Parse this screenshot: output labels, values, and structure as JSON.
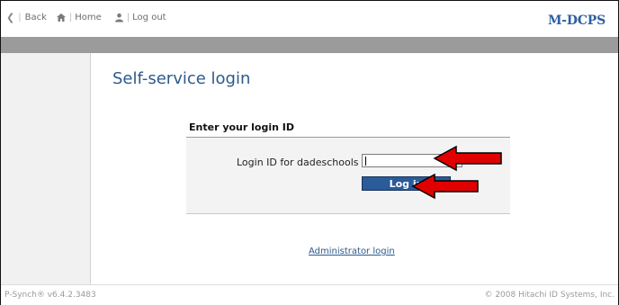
{
  "nav": {
    "back_label": "Back",
    "home_label": "Home",
    "logout_label": "Log out"
  },
  "brand": {
    "logo_text": "M-DCPS",
    "color": "#2e5fa3"
  },
  "page": {
    "title": "Self-service login"
  },
  "form": {
    "heading": "Enter your login ID",
    "field_label": "Login ID for dadeschools :",
    "field_value": "",
    "button_label": "Log in"
  },
  "links": {
    "admin_login": "Administrator login"
  },
  "footer": {
    "version": "P-Synch® v6.4.2.3483",
    "copyright": "© 2008 Hitachi ID Systems, Inc."
  },
  "annotations": {
    "arrow_color": "#e00000"
  }
}
